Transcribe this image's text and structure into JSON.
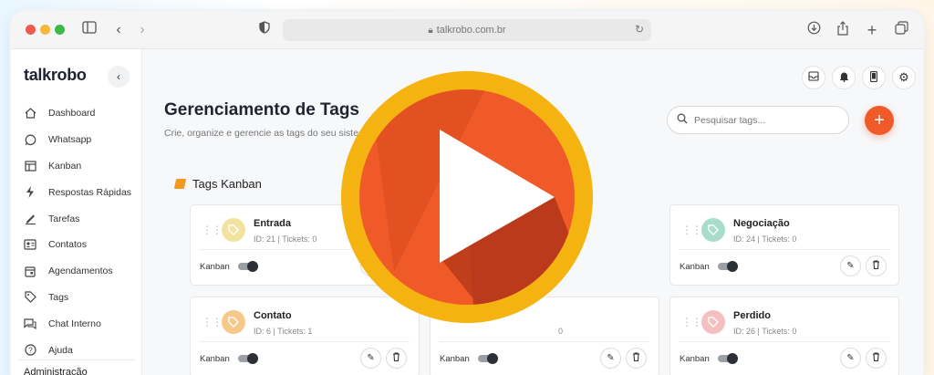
{
  "browser": {
    "url": "talkrobo.com.br"
  },
  "sidebar": {
    "logo": "talkrobo",
    "items": [
      {
        "label": "Dashboard",
        "icon": "home-icon"
      },
      {
        "label": "Whatsapp",
        "icon": "whatsapp-icon"
      },
      {
        "label": "Kanban",
        "icon": "kanban-icon"
      },
      {
        "label": "Respostas Rápidas",
        "icon": "bolt-icon"
      },
      {
        "label": "Tarefas",
        "icon": "pencil-icon"
      },
      {
        "label": "Contatos",
        "icon": "contacts-icon"
      },
      {
        "label": "Agendamentos",
        "icon": "calendar-icon"
      },
      {
        "label": "Tags",
        "icon": "tag-icon"
      },
      {
        "label": "Chat Interno",
        "icon": "chat-icon"
      },
      {
        "label": "Ajuda",
        "icon": "help-icon"
      }
    ],
    "section": "Administração"
  },
  "page": {
    "title": "Gerenciamento de Tags",
    "subtitle": "Crie, organize e gerencie as tags do seu siste",
    "search_placeholder": "Pesquisar tags...",
    "section_title": "Tags Kanban"
  },
  "cards": [
    {
      "name": "Entrada",
      "meta": "ID: 21 | Tickets: 0",
      "kanban_label": "Kanban",
      "color": "#f3e3a0"
    },
    {
      "name": "Negociação",
      "meta": "ID: 24 | Tickets: 0",
      "kanban_label": "Kanban",
      "color": "#a8ddcc"
    },
    {
      "name": "Contato",
      "meta": "ID: 6 | Tickets: 1",
      "kanban_label": "Kanban",
      "color": "#f6c98a"
    },
    {
      "name": "",
      "meta": "0",
      "kanban_label": "Kanban",
      "color": "#ffffff"
    },
    {
      "name": "Perdido",
      "meta": "ID: 26 | Tickets: 0",
      "kanban_label": "Kanban",
      "color": "#f4c0bf"
    }
  ],
  "colors": {
    "accent": "#f05a28",
    "play_ring": "#f5b312",
    "play_fill": "#f05a28"
  }
}
